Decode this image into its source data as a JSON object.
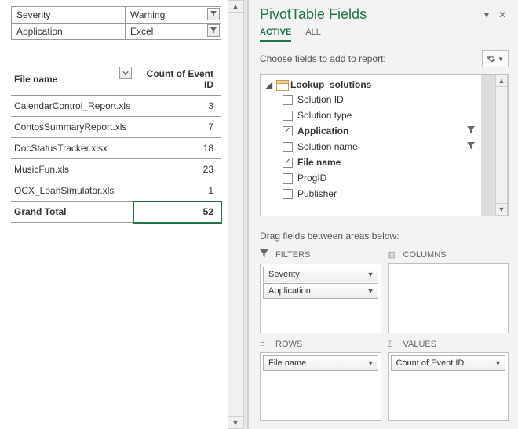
{
  "filters": {
    "severity_label": "Severity",
    "severity_value": "Warning",
    "application_label": "Application",
    "application_value": "Excel"
  },
  "pivot": {
    "row_header": "File name",
    "value_header": "Count of Event ID",
    "rows": [
      {
        "label": "CalendarControl_Report.xls",
        "value": "3"
      },
      {
        "label": "ContosSummaryReport.xls",
        "value": "7"
      },
      {
        "label": "DocStatusTracker.xlsx",
        "value": "18"
      },
      {
        "label": "MusicFun.xls",
        "value": "23"
      },
      {
        "label": "OCX_LoanSimulator.xls",
        "value": "1"
      }
    ],
    "grand_total_label": "Grand Total",
    "grand_total_value": "52"
  },
  "pane": {
    "title": "PivotTable Fields",
    "tabs": {
      "active": "ACTIVE",
      "all": "ALL"
    },
    "choose_label": "Choose fields to add to report:"
  },
  "field_table": {
    "name": "Lookup_solutions",
    "fields": [
      {
        "label": "Solution ID",
        "checked": false,
        "bold": false,
        "filter": false
      },
      {
        "label": "Solution type",
        "checked": false,
        "bold": false,
        "filter": false
      },
      {
        "label": "Application",
        "checked": true,
        "bold": true,
        "filter": true
      },
      {
        "label": "Solution name",
        "checked": false,
        "bold": false,
        "filter": true
      },
      {
        "label": "File name",
        "checked": true,
        "bold": true,
        "filter": false
      },
      {
        "label": "ProgID",
        "checked": false,
        "bold": false,
        "filter": false
      },
      {
        "label": "Publisher",
        "checked": false,
        "bold": false,
        "filter": false
      }
    ]
  },
  "drag_label": "Drag fields between areas below:",
  "areas": {
    "filters_label": "FILTERS",
    "columns_label": "COLUMNS",
    "rows_label": "ROWS",
    "values_label": "VALUES",
    "filters_items": [
      {
        "label": "Severity"
      },
      {
        "label": "Application"
      }
    ],
    "columns_items": [],
    "rows_items": [
      {
        "label": "File name"
      }
    ],
    "values_items": [
      {
        "label": "Count of Event ID"
      }
    ]
  }
}
